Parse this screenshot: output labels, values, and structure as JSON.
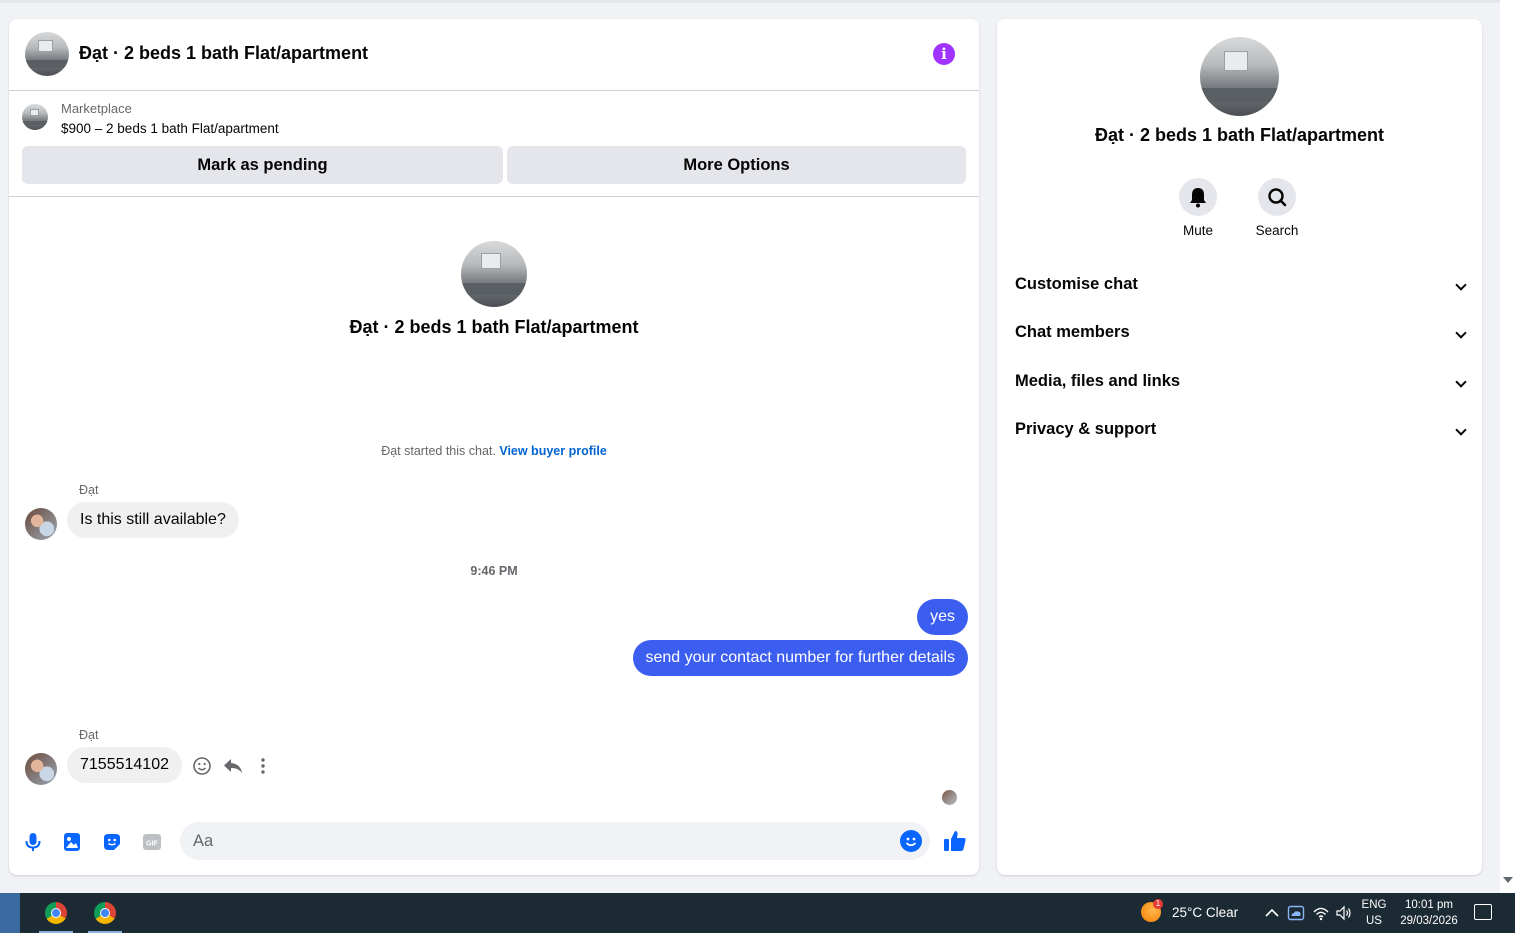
{
  "chat": {
    "header_title": "Đạt · 2 beds 1 bath Flat/apartment",
    "info_icon": "info-icon",
    "marketplace_label": "Marketplace",
    "listing_price_title": "$900 – 2 beds 1 bath Flat/apartment",
    "mark_pending_label": "Mark as pending",
    "more_options_label": "More Options",
    "center_title": "Đạt · 2 beds 1 bath Flat/apartment",
    "started_text": "Đạt started this chat.",
    "view_buyer_profile": "View buyer profile",
    "messages": [
      {
        "sender": "Đạt",
        "text": "Is this still available?",
        "direction": "in"
      },
      {
        "time": "9:46 PM"
      },
      {
        "text": "yes",
        "direction": "out"
      },
      {
        "text": "send your contact number for further details",
        "direction": "out"
      },
      {
        "sender": "Đạt",
        "text": "7155514102",
        "direction": "in"
      }
    ],
    "composer_placeholder": "Aa",
    "accent_color": "#0866ff",
    "outgoing_bubble_color": "#3c5ef0"
  },
  "details": {
    "title": "Đạt · 2 beds 1 bath Flat/apartment",
    "mute_label": "Mute",
    "search_label": "Search",
    "sections": [
      "Customise chat",
      "Chat members",
      "Media, files and links",
      "Privacy & support"
    ]
  },
  "taskbar": {
    "weather": "25°C  Clear",
    "weather_badge": "1",
    "lang_line1": "ENG",
    "lang_line2": "US",
    "time": "10:01 pm",
    "date": "29/03/2026"
  }
}
